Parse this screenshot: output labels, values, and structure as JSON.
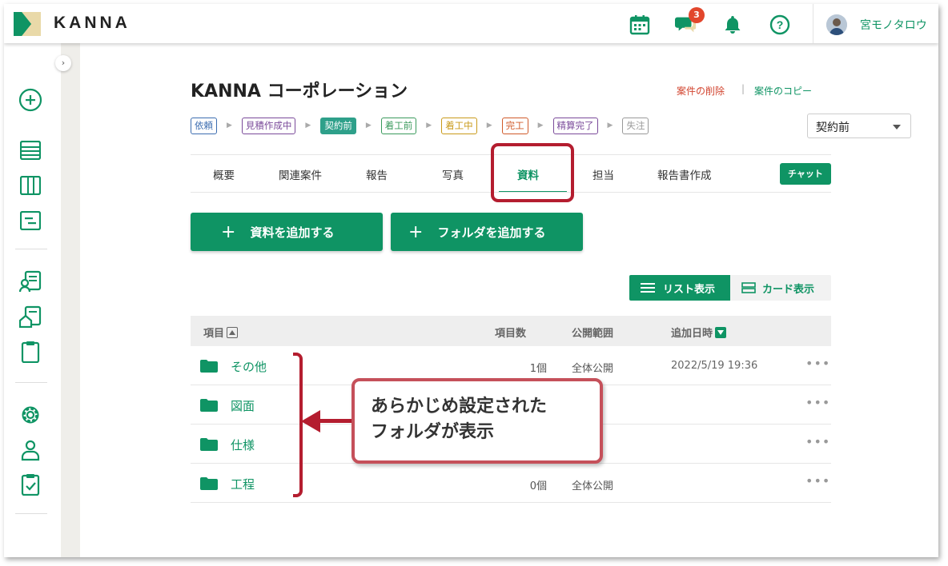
{
  "header": {
    "logo_text": "KANNA",
    "notification_count": "3",
    "user_name": "宮モノタロウ",
    "icons": [
      "calendar-icon",
      "chat-icon",
      "bell-icon",
      "help-icon"
    ],
    "accent_color": "#0f9464"
  },
  "sidebar": {
    "toggle": "›",
    "icons": [
      "add-circle-icon",
      "list-view-icon",
      "column-view-icon",
      "gantt-view-icon",
      "customer-icon",
      "property-icon",
      "clipboard-icon",
      "settings-icon",
      "user-icon",
      "checklist-icon"
    ]
  },
  "case": {
    "title": "KANNA コーポレーション",
    "delete_link": "案件の削除",
    "link_separator": "|",
    "copy_link": "案件のコピー",
    "status_value": "契約前"
  },
  "steps": [
    {
      "label": "依頼",
      "color": "#3c6db0",
      "filled": false
    },
    {
      "label": "見積作成中",
      "color": "#7a4a9a",
      "filled": false
    },
    {
      "label": "契約前",
      "color": "#2ea08a",
      "filled": true
    },
    {
      "label": "着工前",
      "color": "#3a9a5c",
      "filled": false
    },
    {
      "label": "着工中",
      "color": "#c99a1a",
      "filled": false
    },
    {
      "label": "完工",
      "color": "#d05a2a",
      "filled": false
    },
    {
      "label": "精算完了",
      "color": "#7a4a9a",
      "filled": false
    },
    {
      "label": "失注",
      "color": "#999999",
      "filled": false
    }
  ],
  "tabs": [
    "概要",
    "関連案件",
    "報告",
    "写真",
    "資料",
    "担当",
    "報告書作成"
  ],
  "active_tab": "資料",
  "chat_button": "チャット",
  "buttons": {
    "add_file": "資料を追加する",
    "add_folder": "フォルダを追加する",
    "plus": "+"
  },
  "view_toggle": {
    "list": "リスト表示",
    "card": "カード表示"
  },
  "table": {
    "headers": {
      "item": "項目",
      "count": "項目数",
      "scope": "公開範囲",
      "date": "追加日時"
    },
    "rows": [
      {
        "name": "その他",
        "count": "1個",
        "scope": "全体公開",
        "date": "2022/5/19 19:36",
        "more": "•••"
      },
      {
        "name": "図面",
        "count": "",
        "scope": "",
        "date": "",
        "more": "•••"
      },
      {
        "name": "仕様",
        "count": "",
        "scope": "",
        "date": "",
        "more": "•••"
      },
      {
        "name": "工程",
        "count": "0個",
        "scope": "全体公開",
        "date": "",
        "more": "•••"
      }
    ]
  },
  "callout": {
    "line1": "あらかじめ設定された",
    "line2": "フォルダが表示"
  }
}
